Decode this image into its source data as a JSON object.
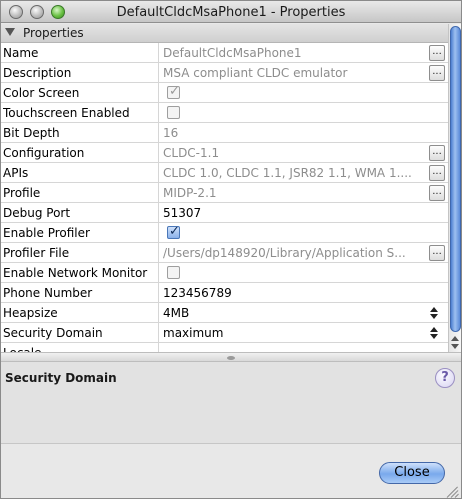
{
  "window": {
    "title": "DefaultCldcMsaPhone1 - Properties"
  },
  "category": {
    "label": "Properties"
  },
  "properties": [
    {
      "name": "Name",
      "value": "DefaultCldcMsaPhone1",
      "kind": "text",
      "readonly": true,
      "button": "..."
    },
    {
      "name": "Description",
      "value": "MSA compliant CLDC emulator",
      "kind": "text",
      "readonly": true,
      "button": "..."
    },
    {
      "name": "Color Screen",
      "value": "",
      "kind": "checkbox",
      "checked": true,
      "readonly": true
    },
    {
      "name": "Touchscreen Enabled",
      "value": "",
      "kind": "checkbox",
      "checked": false,
      "readonly": true
    },
    {
      "name": "Bit Depth",
      "value": "16",
      "kind": "text",
      "readonly": true
    },
    {
      "name": "Configuration",
      "value": "CLDC-1.1",
      "kind": "text",
      "readonly": true,
      "button": "..."
    },
    {
      "name": "APIs",
      "value": "CLDC 1.0, CLDC 1.1, JSR82 1.1, WMA 1....",
      "kind": "text",
      "readonly": true,
      "button": "..."
    },
    {
      "name": "Profile",
      "value": "MIDP-2.1",
      "kind": "text",
      "readonly": true,
      "button": "..."
    },
    {
      "name": "Debug Port",
      "value": "51307",
      "kind": "text",
      "readonly": false
    },
    {
      "name": "Enable Profiler",
      "value": "",
      "kind": "checkbox",
      "checked": true,
      "readonly": false
    },
    {
      "name": "Profiler File",
      "value": "/Users/dp148920/Library/Application S...",
      "kind": "text",
      "readonly": true,
      "button": "..."
    },
    {
      "name": "Enable Network Monitor",
      "value": "",
      "kind": "checkbox",
      "checked": false,
      "readonly": false
    },
    {
      "name": "Phone Number",
      "value": "123456789",
      "kind": "text",
      "readonly": false
    },
    {
      "name": "Heapsize",
      "value": "4MB",
      "kind": "select",
      "readonly": false
    },
    {
      "name": "Security Domain",
      "value": "maximum",
      "kind": "select",
      "readonly": false
    },
    {
      "name": "Locale",
      "value": "",
      "kind": "text",
      "readonly": false
    }
  ],
  "description": {
    "title": "Security Domain"
  },
  "help_glyph": "?",
  "close_label": "Close",
  "colors": {
    "accent": "#79a9ec",
    "readonly_text": "#8d8d8d"
  },
  "icons": [
    "close-window-icon",
    "minimize-window-icon",
    "zoom-window-icon",
    "collapse-triangle-icon",
    "checkmark-icon",
    "spinner-arrows-icon",
    "help-icon",
    "resize-grip-icon"
  ]
}
